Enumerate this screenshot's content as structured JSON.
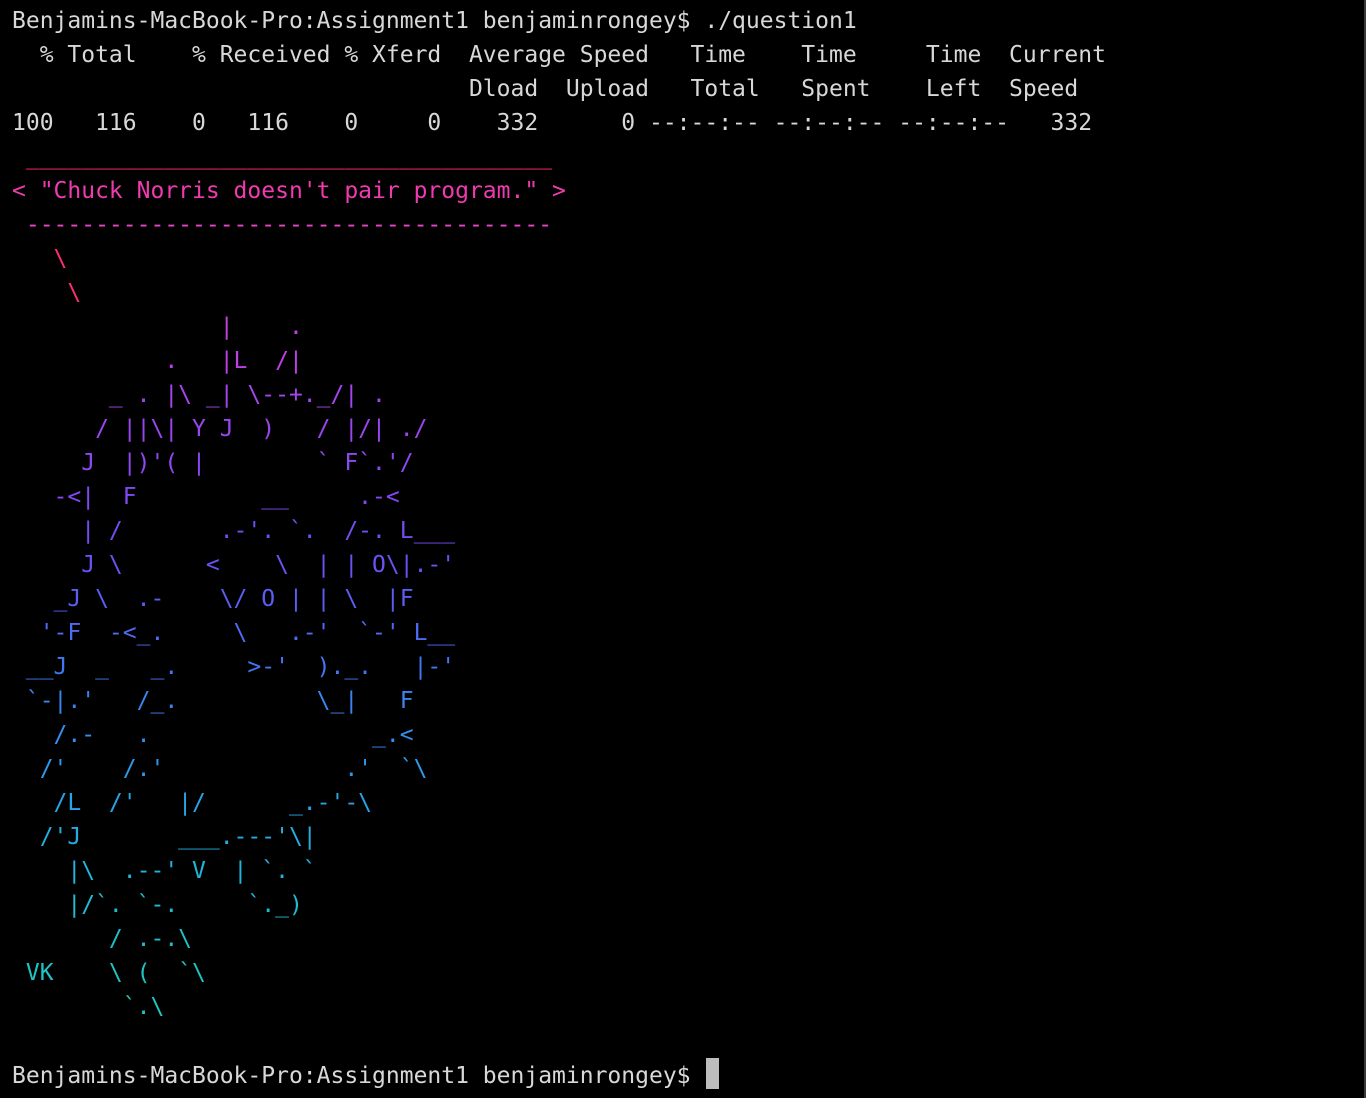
{
  "terminal": {
    "prompt": "Benjamins-MacBook-Pro:Assignment1 benjaminrongey$",
    "command": " ./question1",
    "default_text_color": "#d8d8d8",
    "background_color": "#000000"
  },
  "curl_progress": {
    "header_row_1": "  % Total    % Received % Xferd  Average Speed   Time    Time     Time  Current",
    "header_row_2": "                                 Dload  Upload   Total   Spent    Left  Speed",
    "values_row": "100   116    0   116    0     0    332      0 --:--:-- --:--:-- --:--:--   332"
  },
  "cowsay": {
    "lines": [
      {
        "text": " ______________________________________",
        "color": "#ff2d6f"
      },
      {
        "text": "< \"Chuck Norris doesn't pair program.\" >",
        "color": "#f03bb0"
      },
      {
        "text": " --------------------------------------",
        "color": "#e945c8"
      },
      {
        "text": "   \\",
        "color": "#ff2d6f"
      },
      {
        "text": "    \\",
        "color": "#ff2d7a"
      },
      {
        "text": "               |    .",
        "color": "#c93fe0"
      },
      {
        "text": "           .   |L  /|",
        "color": "#bd3fe6"
      },
      {
        "text": "       _ . |\\ _| \\--+._/| .",
        "color": "#a545ee"
      },
      {
        "text": "      / ||\\| Y J  )   / |/| ./",
        "color": "#9a46f0"
      },
      {
        "text": "     J  |)'( |        ` F`.'/",
        "color": "#8e48f2"
      },
      {
        "text": "   -<|  F         __     .-<",
        "color": "#8149f3"
      },
      {
        "text": "     | /       .-'. `.  /-. L___",
        "color": "#754cf4"
      },
      {
        "text": "     J \\      <    \\  | | O\\|.-'",
        "color": "#6a52f3"
      },
      {
        "text": "   _J \\  .-    \\/ O | | \\  |F",
        "color": "#5a5ef3"
      },
      {
        "text": "  '-F  -<_.     \\   .-'  `-' L__",
        "color": "#4d6bf3"
      },
      {
        "text": " __J  _   _.     >-'  )._.   |-'",
        "color": "#4277f3"
      },
      {
        "text": " `-|.'   /_.          \\_|   F",
        "color": "#3985f0"
      },
      {
        "text": "   /.-   .                _.<",
        "color": "#3290ee"
      },
      {
        "text": "  /'    /.'             .'  `\\",
        "color": "#2c9aea"
      },
      {
        "text": "   /L  /'   |/      _.-'-\\",
        "color": "#28a4e6"
      },
      {
        "text": "  /'J       ___.---'\\|",
        "color": "#25ade0"
      },
      {
        "text": "    |\\  .--' V  | `. `",
        "color": "#22b4da"
      },
      {
        "text": "    |/`. `-.     `._)",
        "color": "#20bad2"
      },
      {
        "text": "       / .-.\\",
        "color": "#1fbfca"
      },
      {
        "text": " VK    \\ (  `\\",
        "color": "#1fc3c3"
      },
      {
        "text": "        `.\\",
        "color": "#20c6bd"
      }
    ]
  }
}
